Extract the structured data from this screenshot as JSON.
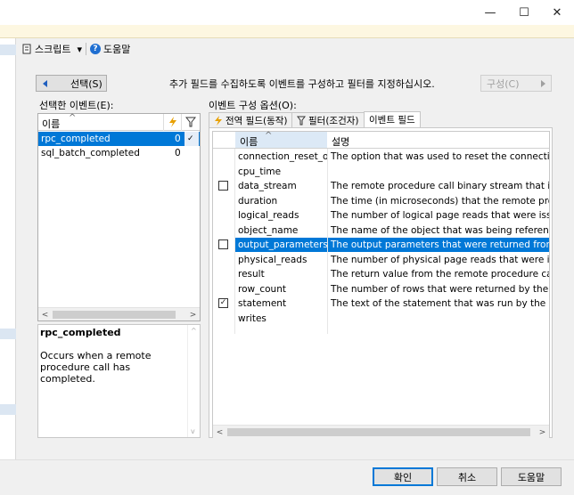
{
  "window": {
    "minimize": "—",
    "maximize": "☐",
    "close": "✕"
  },
  "toolbar": {
    "script_label": "스크립트",
    "dropdown": "▾",
    "help_label": "도움말",
    "help_glyph": "?"
  },
  "nav": {
    "select_label": "선택(S)",
    "configure_label": "구성(C)",
    "instruction": "추가 필드를 수집하도록 이벤트를 구성하고 필터를 지정하십시오."
  },
  "selected_events": {
    "title": "선택한 이벤트(E):",
    "col_name": "이름",
    "rows": [
      {
        "name": "rpc_completed",
        "count": "0",
        "filtered": true,
        "selected": true
      },
      {
        "name": "sql_batch_completed",
        "count": "0",
        "filtered": false,
        "selected": false
      }
    ]
  },
  "description": {
    "title": "rpc_completed",
    "text": "Occurs when a remote procedure call has completed."
  },
  "options": {
    "title": "이벤트 구성 옵션(O):",
    "tabs": [
      {
        "label": "전역 필드(동작)",
        "icon": "lightning-icon"
      },
      {
        "label": "필터(조건자)",
        "icon": "filter-icon"
      },
      {
        "label": "이벤트 필드",
        "icon": ""
      }
    ],
    "col_name": "이름",
    "col_desc": "설명",
    "fields": [
      {
        "checkbox": "none",
        "name": "connection_reset_o...",
        "desc": "The option that was used to reset the connection. This",
        "selected": false
      },
      {
        "checkbox": "none",
        "name": "cpu_time",
        "desc": "",
        "selected": false
      },
      {
        "checkbox": "empty",
        "name": "data_stream",
        "desc": "The remote procedure call binary stream that is used fo",
        "selected": false
      },
      {
        "checkbox": "none",
        "name": "duration",
        "desc": "The time (in microseconds) that the remote procedure",
        "selected": false
      },
      {
        "checkbox": "none",
        "name": "logical_reads",
        "desc": "The number of logical page reads that were issued by",
        "selected": false
      },
      {
        "checkbox": "none",
        "name": "object_name",
        "desc": "The name of the object that was being referenced by th",
        "selected": false
      },
      {
        "checkbox": "empty",
        "name": "output_parameters",
        "desc": "The output parameters that were returned from the remo",
        "selected": true
      },
      {
        "checkbox": "none",
        "name": "physical_reads",
        "desc": "The number of physical page reads that were issued b",
        "selected": false
      },
      {
        "checkbox": "none",
        "name": "result",
        "desc": "The return value from the remote procedure call.",
        "selected": false
      },
      {
        "checkbox": "none",
        "name": "row_count",
        "desc": "The number of rows that were returned by the remote p",
        "selected": false
      },
      {
        "checkbox": "checked",
        "name": "statement",
        "desc": "The text of the statement that was run by the remote pr",
        "selected": false
      },
      {
        "checkbox": "none",
        "name": "writes",
        "desc": "",
        "selected": false
      }
    ]
  },
  "footer": {
    "ok": "확인",
    "cancel": "취소",
    "help": "도움말"
  },
  "colors": {
    "accent": "#0078d7",
    "selection": "#0078d7",
    "info_bar": "#fdf7e1"
  }
}
